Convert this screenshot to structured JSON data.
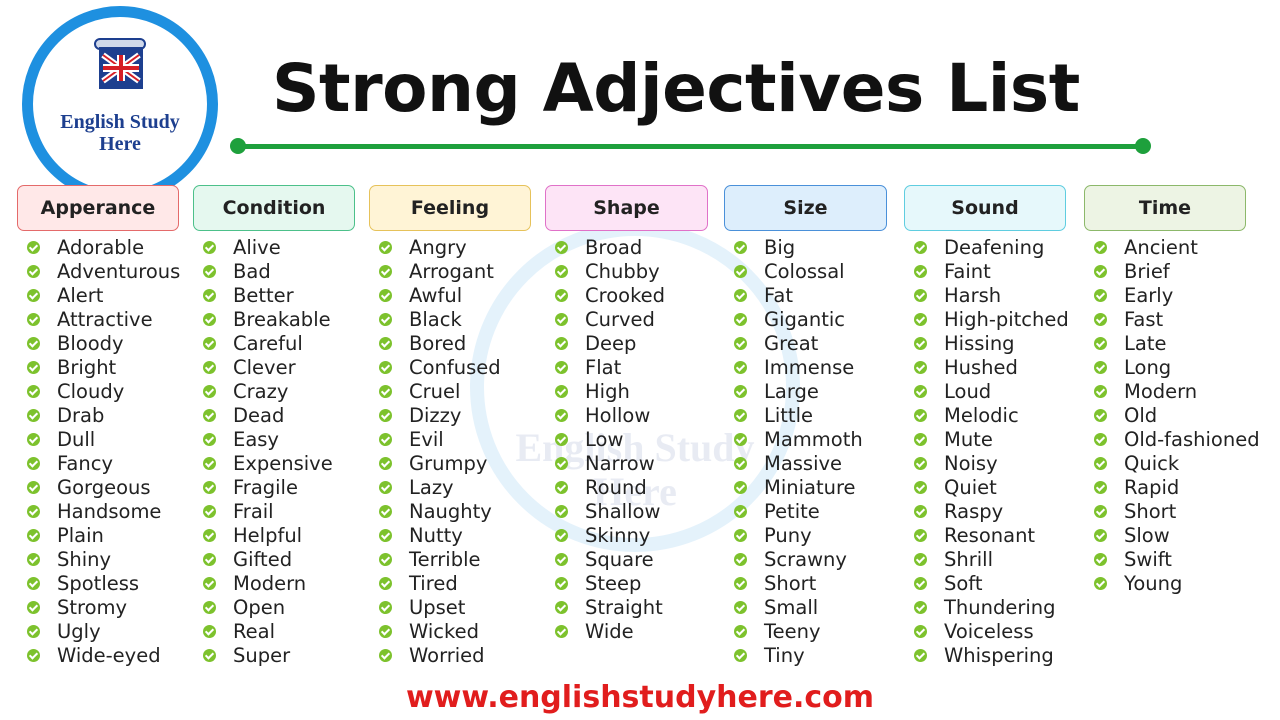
{
  "logo": {
    "line1": "English Study",
    "line2": "Here"
  },
  "title": "Strong Adjectives List",
  "watermark": {
    "line1": "English Study",
    "line2": "Here"
  },
  "colors": {
    "accent_green": "#1ea03c",
    "check_green": "#7dc22d",
    "logo_blue": "#1e90e0",
    "footer_red": "#e11d1d"
  },
  "columns": [
    {
      "heading": "Apperance",
      "bg": "#ffe8e8",
      "border": "#e46a6a",
      "items": [
        "Adorable",
        "Adventurous",
        "Alert",
        "Attractive",
        "Bloody",
        "Bright",
        "Cloudy",
        "Drab",
        "Dull",
        "Fancy",
        "Gorgeous",
        "Handsome",
        "Plain",
        "Shiny",
        "Spotless",
        "Stromy",
        "Ugly",
        "Wide-eyed"
      ]
    },
    {
      "heading": "Condition",
      "bg": "#e5f8ef",
      "border": "#4cc08a",
      "items": [
        "Alive",
        "Bad",
        "Better",
        "Breakable",
        "Careful",
        "Clever",
        "Crazy",
        "Dead",
        "Easy",
        "Expensive",
        "Fragile",
        "Frail",
        "Helpful",
        "Gifted",
        "Modern",
        "Open",
        "Real",
        "Super"
      ]
    },
    {
      "heading": "Feeling",
      "bg": "#fff4d6",
      "border": "#e6c25a",
      "items": [
        "Angry",
        "Arrogant",
        "Awful",
        "Black",
        "Bored",
        "Confused",
        "Cruel",
        "Dizzy",
        "Evil",
        "Grumpy",
        "Lazy",
        "Naughty",
        "Nutty",
        "Terrible",
        "Tired",
        "Upset",
        "Wicked",
        "Worried"
      ]
    },
    {
      "heading": "Shape",
      "bg": "#fde4f6",
      "border": "#e071c8",
      "items": [
        "Broad",
        "Chubby",
        "Crooked",
        "Curved",
        "Deep",
        "Flat",
        "High",
        "Hollow",
        "Low",
        "Narrow",
        "Round",
        "Shallow",
        "Skinny",
        "Square",
        "Steep",
        "Straight",
        "Wide"
      ]
    },
    {
      "heading": "Size",
      "bg": "#ddeefc",
      "border": "#4a90d9",
      "items": [
        "Big",
        "Colossal",
        "Fat",
        "Gigantic",
        "Great",
        "Immense",
        "Large",
        "Little",
        "Mammoth",
        "Massive",
        "Miniature",
        "Petite",
        "Puny",
        "Scrawny",
        "Short",
        "Small",
        "Teeny",
        "Tiny"
      ]
    },
    {
      "heading": "Sound",
      "bg": "#e6f8fb",
      "border": "#5fcde0",
      "items": [
        "Deafening",
        "Faint",
        "Harsh",
        "High-pitched",
        "Hissing",
        "Hushed",
        "Loud",
        "Melodic",
        "Mute",
        "Noisy",
        "Quiet",
        "Raspy",
        "Resonant",
        "Shrill",
        "Soft",
        "Thundering",
        "Voiceless",
        "Whispering"
      ]
    },
    {
      "heading": "Time",
      "bg": "#edf4e4",
      "border": "#8cb86a",
      "items": [
        "Ancient",
        "Brief",
        "Early",
        "Fast",
        "Late",
        "Long",
        "Modern",
        "Old",
        "Old-fashioned",
        "Quick",
        "Rapid",
        "Short",
        "Slow",
        "Swift",
        "Young"
      ]
    }
  ],
  "footer_url": "www.englishstudyhere.com"
}
